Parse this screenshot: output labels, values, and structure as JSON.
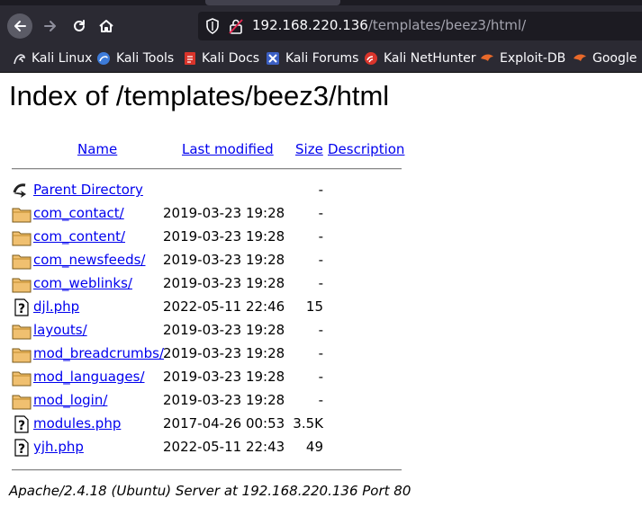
{
  "browser": {
    "url_host": "192.168.220.136",
    "url_path": "/templates/beez3/html/"
  },
  "bookmarks": [
    {
      "label": "Kali Linux",
      "icon": "kali-dragon-icon"
    },
    {
      "label": "Kali Tools",
      "icon": "kali-tools-icon"
    },
    {
      "label": "Kali Docs",
      "icon": "kali-docs-icon"
    },
    {
      "label": "Kali Forums",
      "icon": "kali-forums-icon"
    },
    {
      "label": "Kali NetHunter",
      "icon": "kali-nethunter-icon"
    },
    {
      "label": "Exploit-DB",
      "icon": "exploit-db-icon"
    },
    {
      "label": "Google H",
      "icon": "google-hacking-icon"
    }
  ],
  "page": {
    "title": "Index of /templates/beez3/html",
    "columns": {
      "name": "Name",
      "last_modified": "Last modified",
      "size": "Size",
      "description": "Description"
    },
    "entries": [
      {
        "name": "Parent Directory",
        "date": "",
        "size": "-",
        "type": "parent"
      },
      {
        "name": "com_contact/",
        "date": "2019-03-23 19:28",
        "size": "-",
        "type": "folder"
      },
      {
        "name": "com_content/",
        "date": "2019-03-23 19:28",
        "size": "-",
        "type": "folder"
      },
      {
        "name": "com_newsfeeds/",
        "date": "2019-03-23 19:28",
        "size": "-",
        "type": "folder"
      },
      {
        "name": "com_weblinks/",
        "date": "2019-03-23 19:28",
        "size": "-",
        "type": "folder"
      },
      {
        "name": "djl.php",
        "date": "2022-05-11 22:46",
        "size": "15",
        "type": "file"
      },
      {
        "name": "layouts/",
        "date": "2019-03-23 19:28",
        "size": "-",
        "type": "folder"
      },
      {
        "name": "mod_breadcrumbs/",
        "date": "2019-03-23 19:28",
        "size": "-",
        "type": "folder"
      },
      {
        "name": "mod_languages/",
        "date": "2019-03-23 19:28",
        "size": "-",
        "type": "folder"
      },
      {
        "name": "mod_login/",
        "date": "2019-03-23 19:28",
        "size": "-",
        "type": "folder"
      },
      {
        "name": "modules.php",
        "date": "2017-04-26 00:53",
        "size": "3.5K",
        "type": "file"
      },
      {
        "name": "yjh.php",
        "date": "2022-05-11 22:43",
        "size": "49",
        "type": "file"
      }
    ],
    "footer": "Apache/2.4.18 (Ubuntu) Server at 192.168.220.136 Port 80"
  }
}
